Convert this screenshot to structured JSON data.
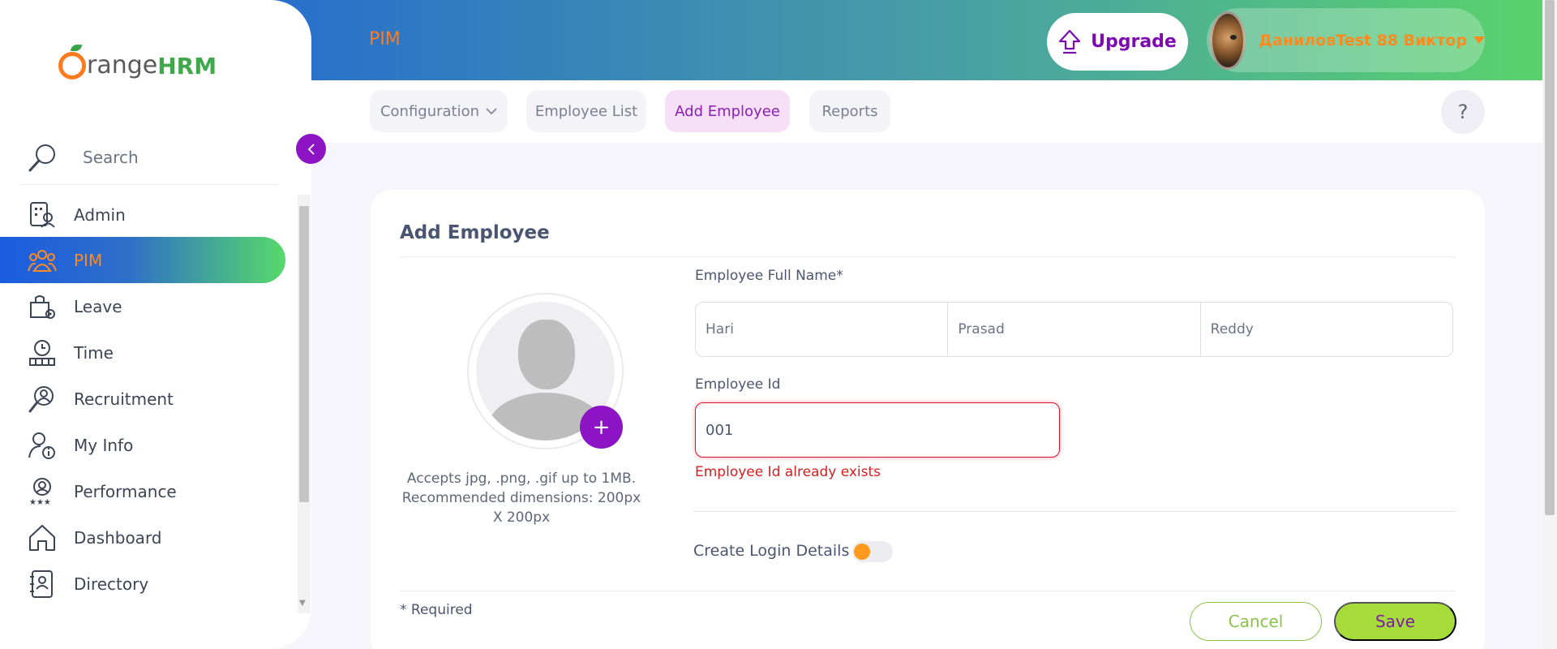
{
  "header": {
    "title": "PIM",
    "upgrade_label": "Upgrade",
    "user_name": "ДаниловTest 88 Виктор"
  },
  "topnav": {
    "items": [
      {
        "label": "Configuration"
      },
      {
        "label": "Employee List"
      },
      {
        "label": "Add Employee"
      },
      {
        "label": "Reports"
      }
    ],
    "active": "Add Employee",
    "help_label": "?"
  },
  "sidebar": {
    "logo_text": "range",
    "logo_hrm": "HRM",
    "search_label": "Search",
    "items": [
      {
        "label": "Admin",
        "icon": "admin-icon"
      },
      {
        "label": "PIM",
        "icon": "pim-icon"
      },
      {
        "label": "Leave",
        "icon": "leave-icon"
      },
      {
        "label": "Time",
        "icon": "time-icon"
      },
      {
        "label": "Recruitment",
        "icon": "recruitment-icon"
      },
      {
        "label": "My Info",
        "icon": "my-info-icon"
      },
      {
        "label": "Performance",
        "icon": "performance-icon"
      },
      {
        "label": "Dashboard",
        "icon": "dashboard-icon"
      },
      {
        "label": "Directory",
        "icon": "directory-icon"
      }
    ],
    "active": "PIM"
  },
  "form": {
    "title": "Add Employee",
    "photo_hint": "Accepts jpg, .png, .gif up to 1MB. Recommended dimensions: 200px X 200px",
    "full_name_label": "Employee Full Name*",
    "first_name": "Hari",
    "middle_name": "Prasad",
    "last_name": "Reddy",
    "employee_id_label": "Employee Id",
    "employee_id_value": "001",
    "employee_id_error": "Employee Id already exists",
    "create_login_label": "Create Login Details",
    "create_login_enabled": false,
    "required_note": "* Required",
    "cancel_label": "Cancel",
    "save_label": "Save"
  },
  "colors": {
    "accent_purple": "#8c14c4",
    "accent_orange": "#ff7b1d",
    "accent_green": "#8bc34a",
    "error_red": "#d42020"
  }
}
